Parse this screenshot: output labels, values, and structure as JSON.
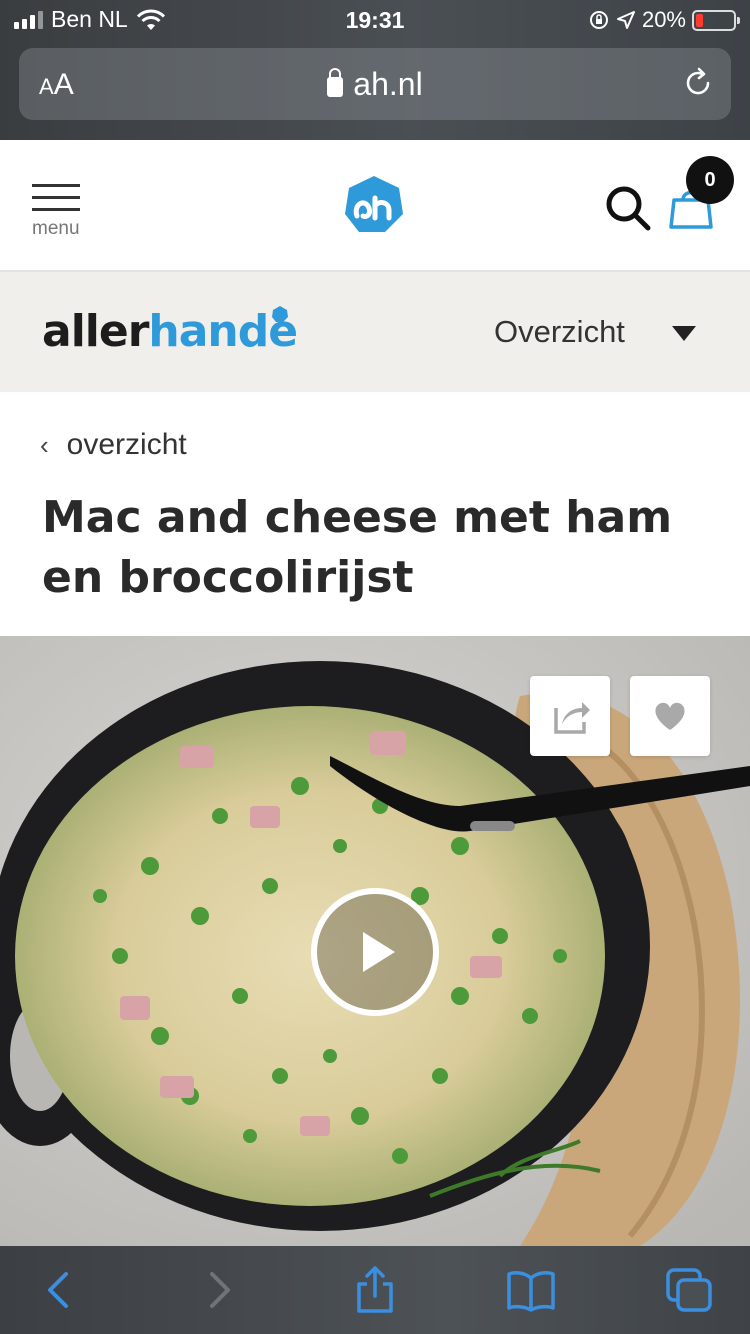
{
  "status_bar": {
    "carrier": "Ben NL",
    "time": "19:31",
    "battery_text": "20%",
    "battery_level": 0.2,
    "icons": [
      "signal-icon",
      "wifi-icon",
      "orientation-lock-icon",
      "location-icon",
      "battery-icon"
    ]
  },
  "browser": {
    "aa_label": "AA",
    "url": "ah.nl",
    "icons": [
      "lock-icon",
      "reload-icon"
    ]
  },
  "header": {
    "menu_label": "menu",
    "cart_count": "0",
    "logo_text": "ah",
    "icons": [
      "menu-icon",
      "ah-logo-icon",
      "search-icon",
      "cart-icon"
    ]
  },
  "sub_header": {
    "brand_part1": "aller",
    "brand_part2": "hande",
    "dropdown_label": "Overzicht"
  },
  "content": {
    "back_label": "overzicht",
    "title": "Mac and cheese met ham en broccolirijst"
  },
  "hero": {
    "icons": [
      "share-icon",
      "heart-icon",
      "play-icon"
    ]
  },
  "toolbar": {
    "icons": [
      "back-icon",
      "forward-icon",
      "share-icon",
      "bookmarks-icon",
      "tabs-icon"
    ]
  },
  "colors": {
    "ah_blue": "#2f9ad9",
    "band_bg": "#f0efec",
    "toolbar_icon": "#3a8fe0"
  }
}
